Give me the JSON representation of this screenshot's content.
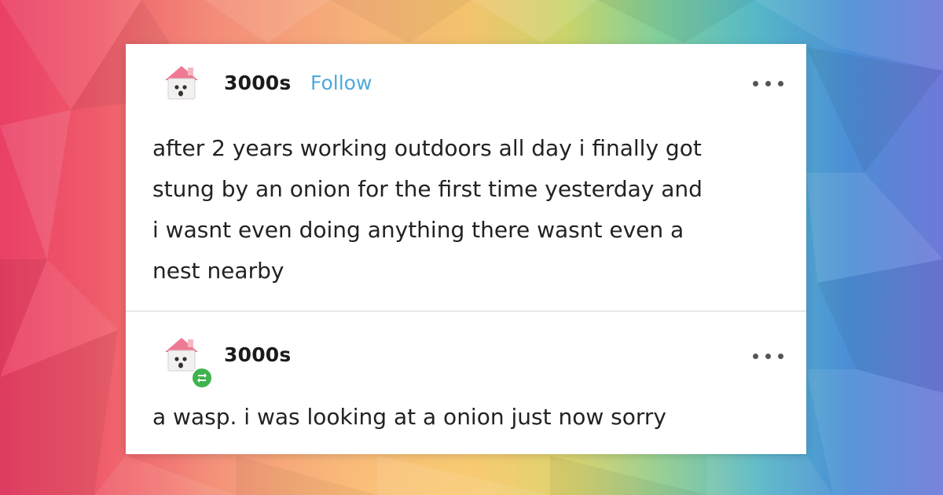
{
  "posts": [
    {
      "username": "3000s",
      "follow_label": "Follow",
      "text": "after 2 years working outdoors all day i finally got stung by an onion for the first time yesterday and i wasnt even doing anything there wasnt even a nest nearby",
      "lines": [
        "after 2 years working outdoors all day i finally got",
        "stung by an onion for the first time yesterday and",
        "i wasnt even doing anything there wasnt even a",
        "nest nearby"
      ]
    },
    {
      "username": "3000s",
      "text": "a wasp. i was looking at a onion just now sorry"
    }
  ],
  "colors": {
    "follow": "#4fa8de",
    "reblog_badge": "#3fb34f",
    "card": "#ffffff",
    "text": "#222222"
  },
  "icons": {
    "avatar": "house-avatar-icon",
    "more": "more-options-icon",
    "reblog": "reblog-icon"
  }
}
